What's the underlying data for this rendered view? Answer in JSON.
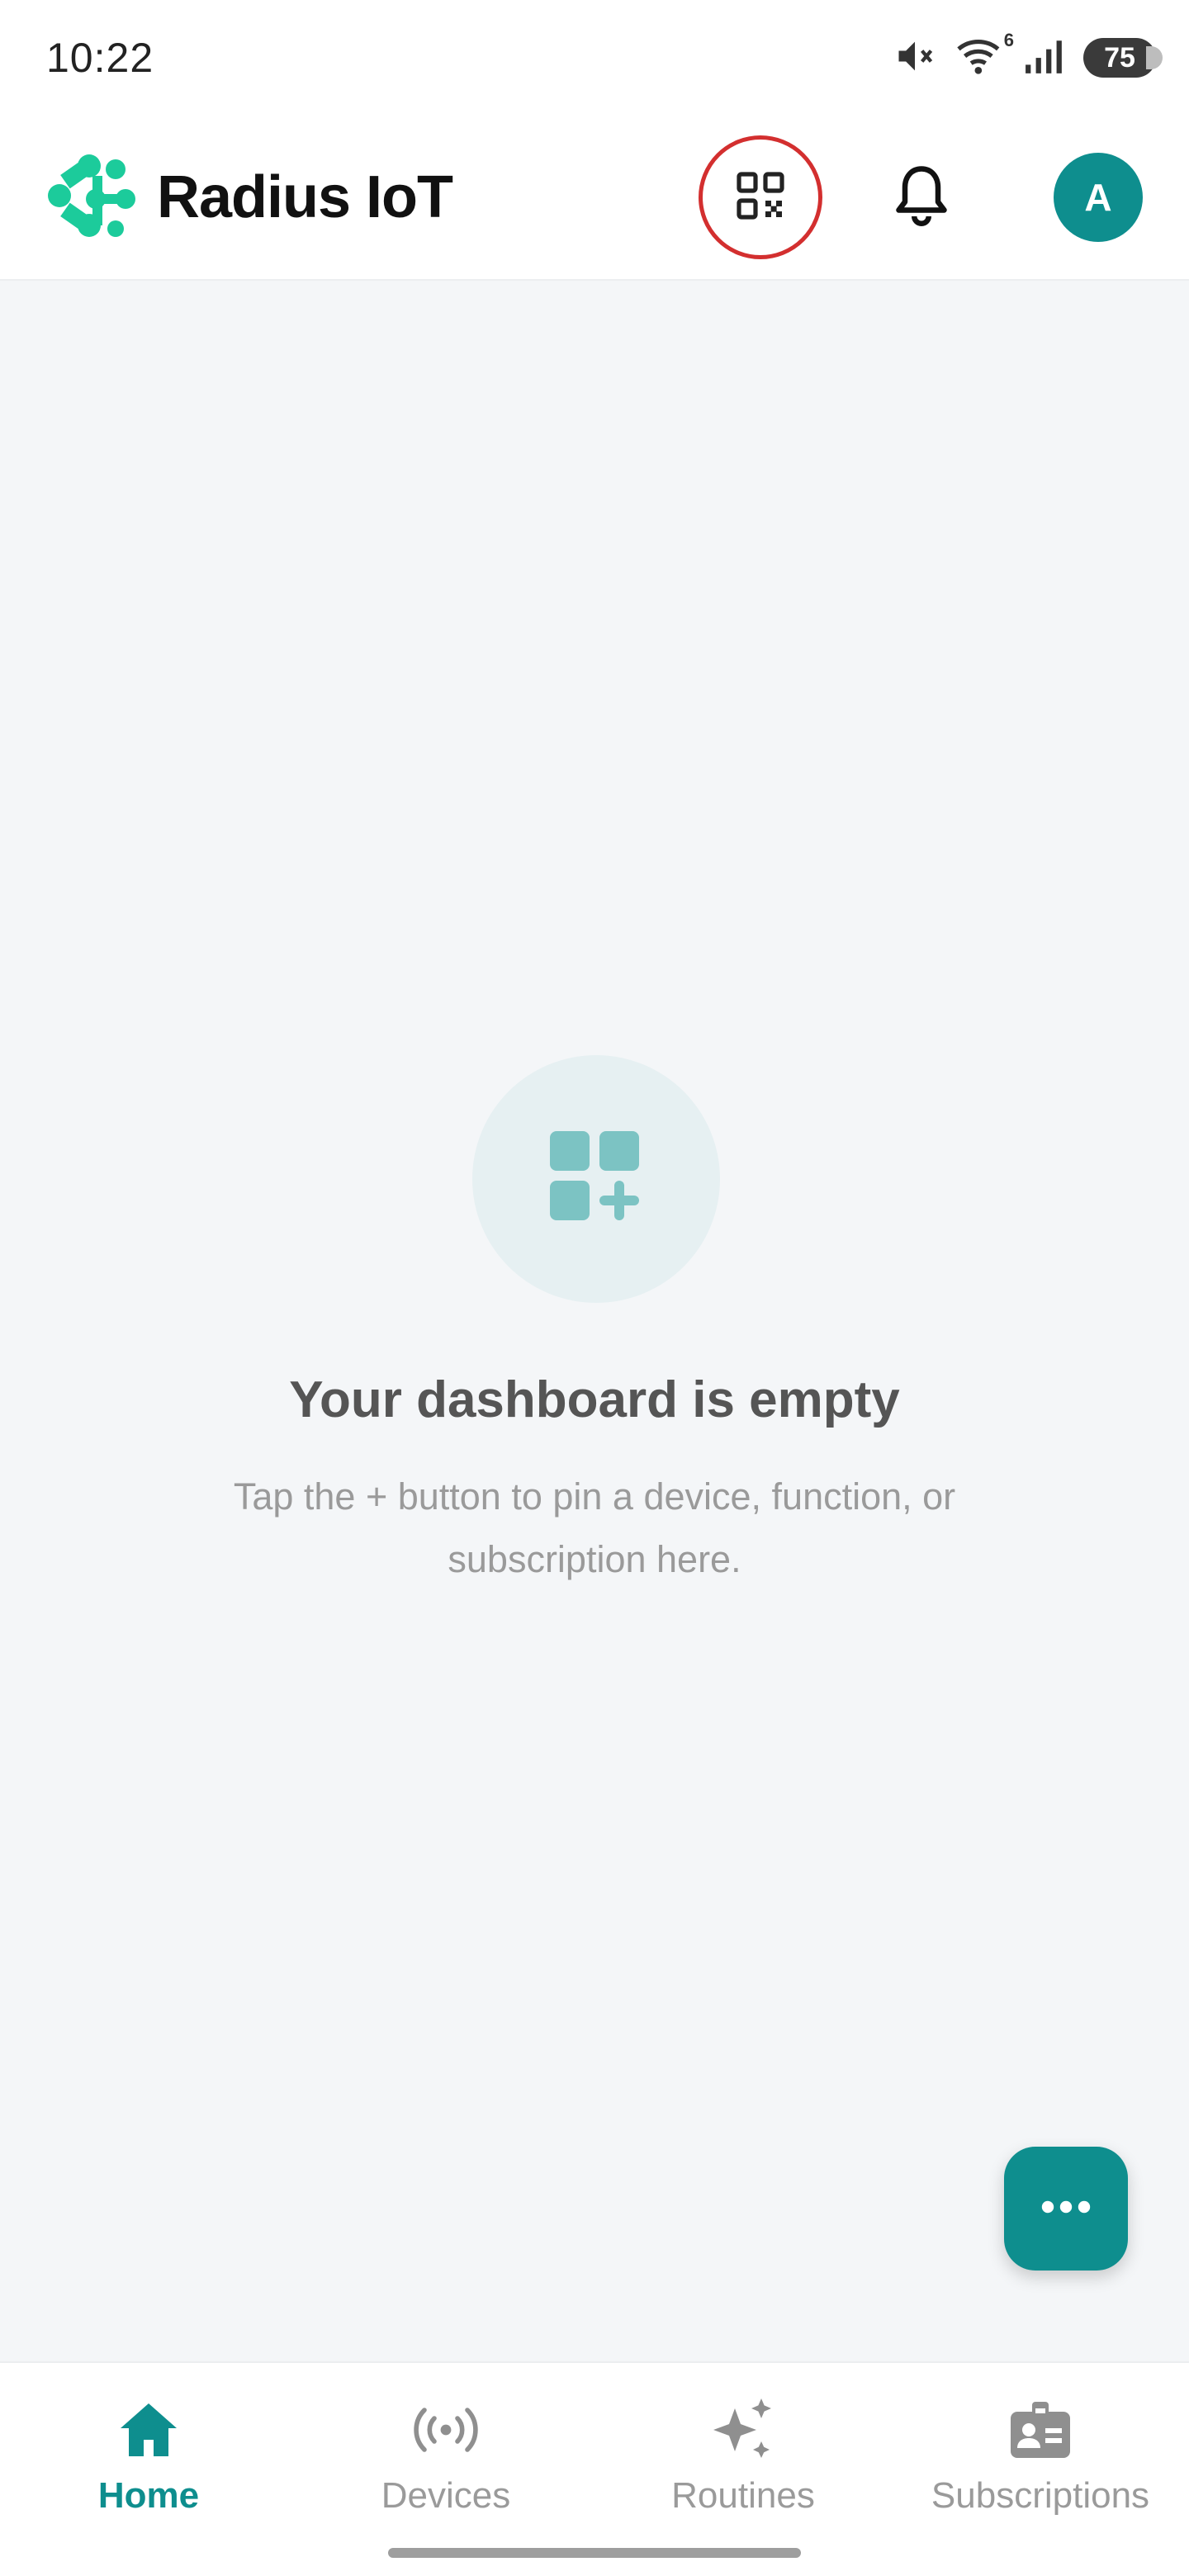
{
  "status_bar": {
    "time": "10:22",
    "battery": "75",
    "wifi_badge": "6",
    "icons": [
      "mute-icon",
      "wifi-icon",
      "signal-icon",
      "battery-icon"
    ]
  },
  "header": {
    "app_name": "Radius IoT",
    "avatar_initial": "A",
    "icons": [
      "logo-icon",
      "qr-scan-icon",
      "bell-icon"
    ]
  },
  "empty_state": {
    "title": "Your dashboard is empty",
    "subtitle": "Tap the + button to pin a device, function, or subscription here.",
    "icon": "dashboard-add-icon"
  },
  "fab": {
    "icon": "more-horizontal-icon"
  },
  "bottom_nav": {
    "items": [
      {
        "label": "Home",
        "icon": "home-icon",
        "active": true
      },
      {
        "label": "Devices",
        "icon": "broadcast-icon",
        "active": false
      },
      {
        "label": "Routines",
        "icon": "sparkles-icon",
        "active": false
      },
      {
        "label": "Subscriptions",
        "icon": "id-badge-icon",
        "active": false
      }
    ]
  },
  "colors": {
    "accent": "#0E8E8E",
    "background": "#F4F6F8",
    "highlight_circle": "#D32F2F",
    "logo": "#1CCB9B"
  }
}
